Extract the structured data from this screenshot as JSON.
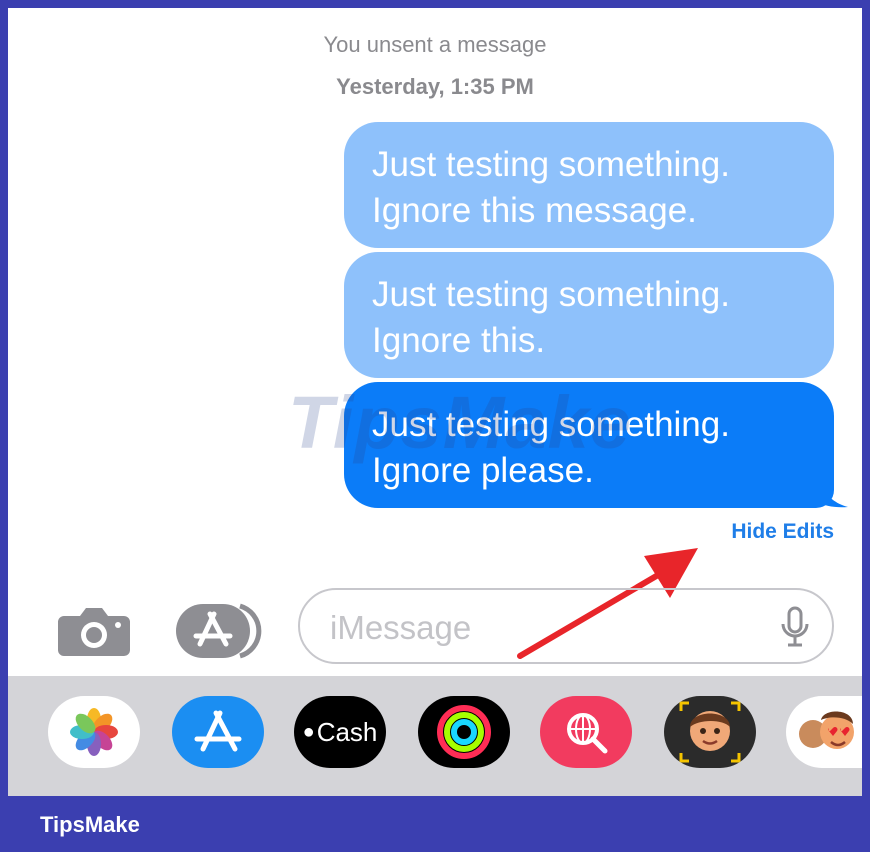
{
  "status": {
    "unsent": "You unsent a message",
    "timestamp": "Yesterday, 1:35 PM"
  },
  "messages": [
    {
      "text": "Just testing something.\nIgnore this message.",
      "state": "edit-history"
    },
    {
      "text": "Just testing something.\nIgnore this.",
      "state": "edit-history"
    },
    {
      "text": "Just testing something.\nIgnore please.",
      "state": "current"
    }
  ],
  "hide_edits_label": "Hide Edits",
  "input": {
    "placeholder": "iMessage"
  },
  "tray_apps": [
    {
      "name": "photos-app",
      "icon": "photos-flower-icon"
    },
    {
      "name": "app-store-app",
      "icon": "app-store-icon"
    },
    {
      "name": "apple-cash-app",
      "label": "Cash",
      "icon": "apple-logo-icon"
    },
    {
      "name": "fitness-app",
      "icon": "activity-rings-icon"
    },
    {
      "name": "search-images-app",
      "icon": "globe-magnifier-icon"
    },
    {
      "name": "memoji-app",
      "icon": "memoji-face-icon"
    },
    {
      "name": "animoji-stickers-app",
      "icon": "heart-eyes-memoji-icon"
    }
  ],
  "watermark": "TipsMake",
  "footer_brand": "TipsMake",
  "colors": {
    "sent_bubble": "#0b7cf8",
    "edited_bubble": "#8ec1fb",
    "link": "#1f7ee8",
    "annotation_arrow": "#e8252a",
    "footer": "#3b3fb0"
  }
}
